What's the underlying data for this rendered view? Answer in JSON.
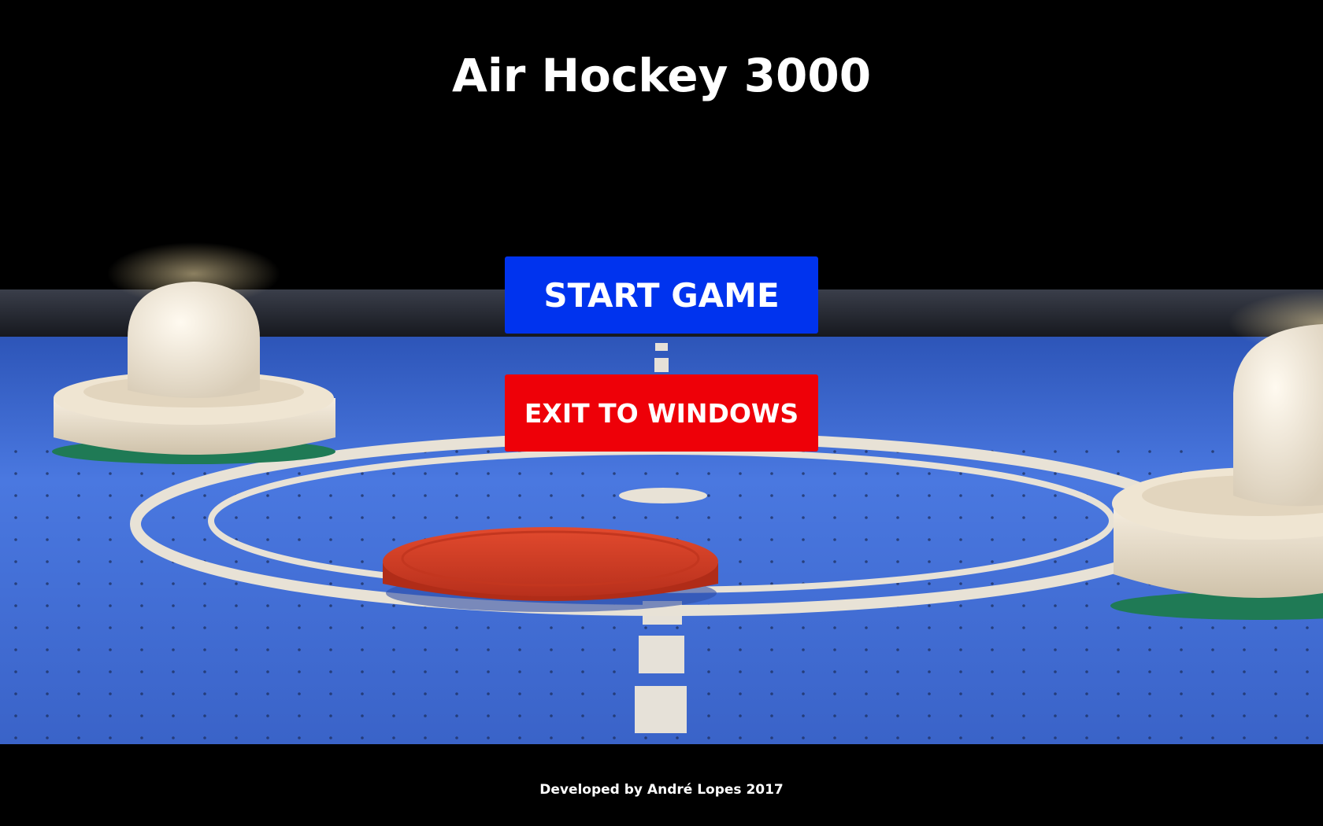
{
  "game": {
    "title": "Air Hockey 3000"
  },
  "menu": {
    "start_label": "START GAME",
    "exit_label": "EXIT TO WINDOWS"
  },
  "footer": {
    "credit": "Developed by André Lopes 2017"
  },
  "colors": {
    "background": "#000000",
    "table_blue": "#3f6fd8",
    "start_button": "#0033ee",
    "exit_button": "#ee0008",
    "puck": "#d84028",
    "mallet": "#efe6d6",
    "text": "#ffffff"
  },
  "icons": {
    "left_mallet": "mallet-icon",
    "right_mallet": "mallet-icon",
    "puck": "puck-icon"
  }
}
